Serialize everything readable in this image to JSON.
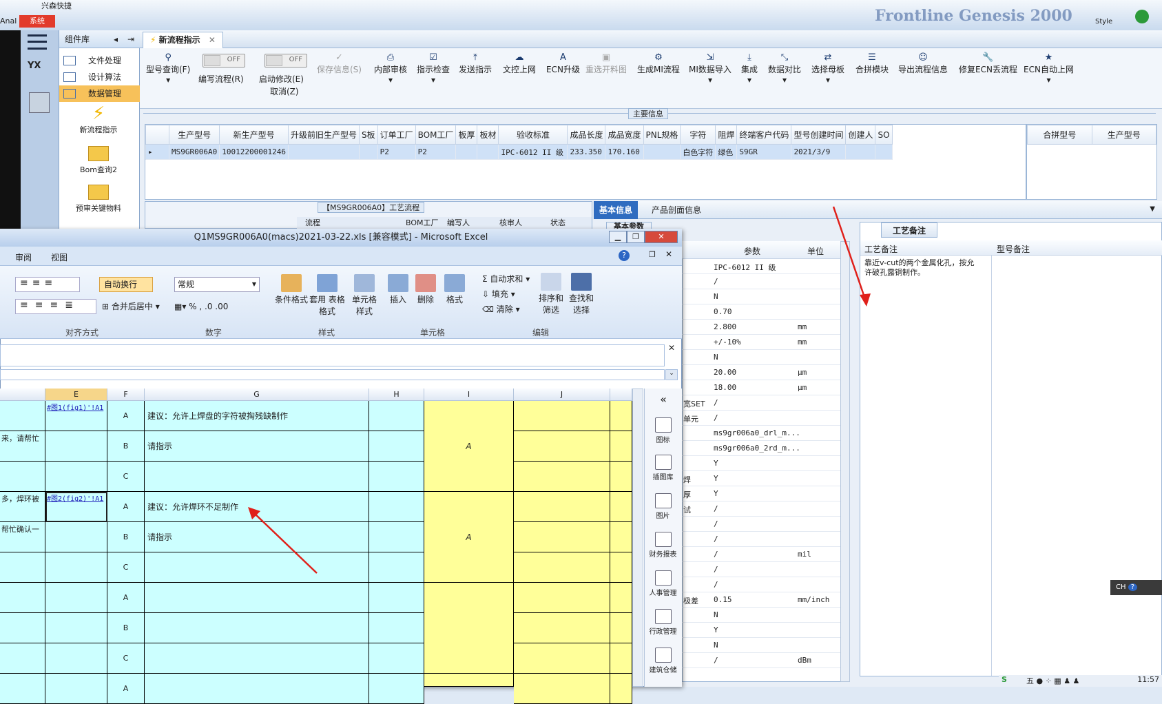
{
  "topbar": {
    "system_label": "系统",
    "app_name_fragment": "兴森快捷",
    "brand": "Frontline Genesis 2000",
    "style_label": "Style",
    "left_fragment": "Anal"
  },
  "library": {
    "title": "组件库",
    "items": [
      {
        "label": "文件处理"
      },
      {
        "label": "设计算法"
      },
      {
        "label": "数据管理"
      }
    ],
    "tiles": [
      {
        "label": "新流程指示"
      },
      {
        "label": "Bom查询2"
      },
      {
        "label": "预审关键物料"
      }
    ],
    "rail_label": "YX"
  },
  "tab": {
    "label": "新流程指示"
  },
  "ribbon": {
    "buttons": [
      {
        "label": "型号查询(F)",
        "icon": "search"
      },
      {
        "label": "保存信息(S)",
        "icon": "check"
      },
      {
        "label": "内部审核",
        "icon": "print"
      },
      {
        "label": "指示检查",
        "icon": "check"
      },
      {
        "label": "发送指示",
        "icon": "upload"
      },
      {
        "label": "文控上网",
        "icon": "cloud"
      },
      {
        "label": "ECN升级",
        "icon": "A"
      },
      {
        "label": "重选开料图",
        "icon": "image"
      },
      {
        "label": "生成MI流程",
        "icon": "gears"
      },
      {
        "label": "MI数据导入",
        "icon": "import"
      },
      {
        "label": "集成",
        "icon": "download"
      },
      {
        "label": "数据对比",
        "icon": "compare"
      },
      {
        "label": "选择母板",
        "icon": "shuffle"
      },
      {
        "label": "合拼模块",
        "icon": "list"
      },
      {
        "label": "导出流程信息",
        "icon": "smile"
      },
      {
        "label": "修复ECN丢流程",
        "icon": "wrench"
      },
      {
        "label": "ECN自动上网",
        "icon": "star"
      }
    ],
    "toggle1": {
      "label": "编写流程(R)",
      "state": "OFF"
    },
    "toggle2": {
      "label": "启动修改(E)",
      "sublabel": "取消(Z)",
      "state": "OFF"
    }
  },
  "main_info": {
    "title": "主要信息",
    "columns": [
      "生产型号",
      "新生产型号",
      "升级前旧生产型号",
      "S板",
      "订单工厂",
      "BOM工厂",
      "板厚",
      "板材",
      "验收标准",
      "成品长度",
      "成品宽度",
      "PNL规格",
      "字符",
      "阻焊",
      "终端客户代码",
      "型号创建时间",
      "创建人",
      "SO"
    ],
    "row": [
      "MS9GR006A0",
      "10012200001246",
      "",
      "",
      "P2",
      "P2",
      "",
      "",
      "IPC-6012 II 级",
      "233.350",
      "170.160",
      "",
      "白色字符",
      "绿色",
      "S9GR",
      "2021/3/9",
      "",
      ""
    ],
    "side_columns": [
      "合拼型号",
      "生产型号"
    ]
  },
  "flow": {
    "title": "【MS9GR006A0】工艺流程",
    "columns": [
      "流程",
      "BOM工厂",
      "编写人",
      "核审人",
      "状态"
    ]
  },
  "info_tabs": {
    "tab1": "基本信息",
    "tab2": "产品剖面信息",
    "subtab": "基本参数"
  },
  "params": {
    "col_param": "参数",
    "col_unit": "单位",
    "rows": [
      {
        "label": "",
        "value": "IPC-6012 II 级",
        "unit": ""
      },
      {
        "label": "",
        "value": "/",
        "unit": ""
      },
      {
        "label": "",
        "value": "N",
        "unit": ""
      },
      {
        "label": "",
        "value": "0.70",
        "unit": ""
      },
      {
        "label": "",
        "value": "2.800",
        "unit": "mm"
      },
      {
        "label": "",
        "value": "+/-10%",
        "unit": "mm"
      },
      {
        "label": "",
        "value": "N",
        "unit": ""
      },
      {
        "label": "",
        "value": "20.00",
        "unit": "μm"
      },
      {
        "label": "",
        "value": "18.00",
        "unit": "μm"
      },
      {
        "label": "宽SET",
        "value": "/",
        "unit": ""
      },
      {
        "label": "单元",
        "value": "/",
        "unit": ""
      },
      {
        "label": "",
        "value": "ms9gr006a0_drl_m...",
        "unit": ""
      },
      {
        "label": "",
        "value": "ms9gr006a0_2rd_m...",
        "unit": ""
      },
      {
        "label": "",
        "value": "Y",
        "unit": ""
      },
      {
        "label": "焊",
        "value": "Y",
        "unit": ""
      },
      {
        "label": "厚",
        "value": "Y",
        "unit": ""
      },
      {
        "label": "试",
        "value": "/",
        "unit": ""
      },
      {
        "label": "",
        "value": "/",
        "unit": ""
      },
      {
        "label": "",
        "value": "/",
        "unit": ""
      },
      {
        "label": "",
        "value": "/",
        "unit": "mil"
      },
      {
        "label": "",
        "value": "/",
        "unit": ""
      },
      {
        "label": "",
        "value": "/",
        "unit": ""
      },
      {
        "label": "极差",
        "value": "0.15",
        "unit": "mm/inch"
      },
      {
        "label": "",
        "value": "N",
        "unit": ""
      },
      {
        "label": "",
        "value": "Y",
        "unit": ""
      },
      {
        "label": "",
        "value": "N",
        "unit": ""
      },
      {
        "label": "",
        "value": "/",
        "unit": "dBm"
      }
    ]
  },
  "notes": {
    "tab": "工艺备注",
    "col1": "工艺备注",
    "col2": "型号备注",
    "text": "靠近v-cut的两个金属化孔，按允许破孔露铜制作。"
  },
  "excel": {
    "title": "Q1MS9GR006A0(macs)2021-03-22.xls  [兼容模式] - Microsoft Excel",
    "menu": [
      "审阅",
      "视图"
    ],
    "wrap_label": "自动换行",
    "format_value": "常规",
    "merge_label": "合并后居中",
    "groups": [
      "对齐方式",
      "数字",
      "样式",
      "单元格",
      "编辑"
    ],
    "buttons": {
      "cond_format": "条件格式",
      "table_format": "套用 表格格式",
      "cell_style": "单元格 样式",
      "insert": "插入",
      "delete": "删除",
      "format": "格式",
      "autosum": "自动求和",
      "fill": "填充",
      "clear": "清除",
      "sort": "排序和 筛选",
      "find": "查找和 选择"
    },
    "columns": [
      "E",
      "F",
      "G",
      "H",
      "I",
      "J"
    ],
    "rows": [
      {
        "e": "#图1(fig1)'!A1",
        "f": "A",
        "g": "建议：允许上焊盘的字符被掏残缺制作",
        "left": ""
      },
      {
        "e": "",
        "f": "B",
        "g": "请指示",
        "left": "来，请帮忙"
      },
      {
        "e": "",
        "f": "C",
        "g": "",
        "left": ""
      },
      {
        "e": "#图2(fig2)'!A1",
        "f": "A",
        "g": "建议：允许焊环不足制作",
        "left": "多，焊环被"
      },
      {
        "e": "",
        "f": "B",
        "g": "请指示",
        "left": "帮忙确认一"
      },
      {
        "e": "",
        "f": "C",
        "g": "",
        "left": ""
      },
      {
        "e": "",
        "f": "A",
        "g": "",
        "left": ""
      },
      {
        "e": "",
        "f": "B",
        "g": "",
        "left": ""
      },
      {
        "e": "",
        "f": "C",
        "g": "",
        "left": ""
      },
      {
        "e": "",
        "f": "A",
        "g": "",
        "left": ""
      }
    ],
    "i_marks": [
      "A",
      "A"
    ],
    "tools": [
      "图标",
      "插图库",
      "图片",
      "财务报表",
      "人事管理",
      "行政管理",
      "建筑仓储"
    ]
  },
  "taskbar": {
    "ime": "CH",
    "clock": "11:57"
  }
}
